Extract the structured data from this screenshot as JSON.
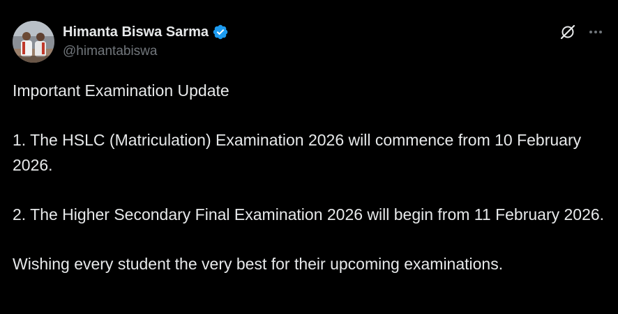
{
  "author": {
    "display_name": "Himanta Biswa Sarma",
    "handle": "@himantabiswa",
    "verified": true,
    "avatar": "profile-photo"
  },
  "actions": {
    "grok_icon": "grok-slash-icon",
    "more_icon": "more-horizontal-icon"
  },
  "tweet": {
    "paragraphs": [
      "Important Examination Update",
      "1. The HSLC (Matriculation) Examination 2026 will commence from 10 February 2026.",
      "2. The Higher Secondary Final Examination 2026 will begin from 11 February 2026.",
      "Wishing every student the very best for their upcoming examinations."
    ]
  },
  "colors": {
    "background": "#000000",
    "text_primary": "#e7e9ea",
    "text_secondary": "#71767b",
    "verified_badge": "#1d9bf0"
  }
}
